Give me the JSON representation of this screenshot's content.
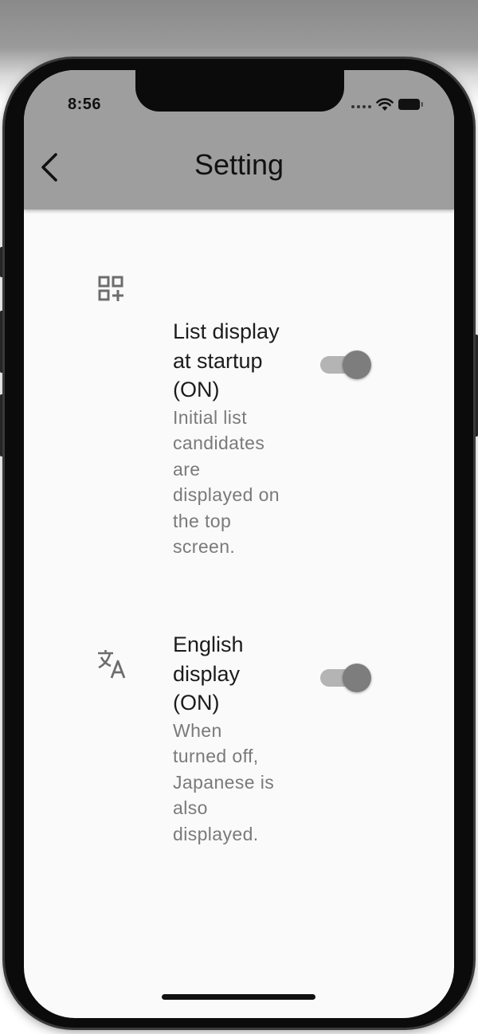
{
  "status_bar": {
    "time": "8:56",
    "icons": [
      "cellular-dots-icon",
      "wifi-icon",
      "battery-icon"
    ]
  },
  "app_bar": {
    "title": "Setting",
    "back_icon": "chevron-left-icon"
  },
  "settings": [
    {
      "icon": "qr-add-icon",
      "title": "List display at startup (ON)",
      "subtitle": "Initial list candidates are displayed on the top screen.",
      "enabled": true
    },
    {
      "icon": "translate-icon",
      "title": "English display (ON)",
      "subtitle": "When turned off, Japanese is also displayed.",
      "enabled": true
    }
  ],
  "colors": {
    "app_bar": "#9e9e9e",
    "background": "#fafafa",
    "switch_thumb": "#7d7d7d",
    "switch_track": "#b4b4b4"
  }
}
